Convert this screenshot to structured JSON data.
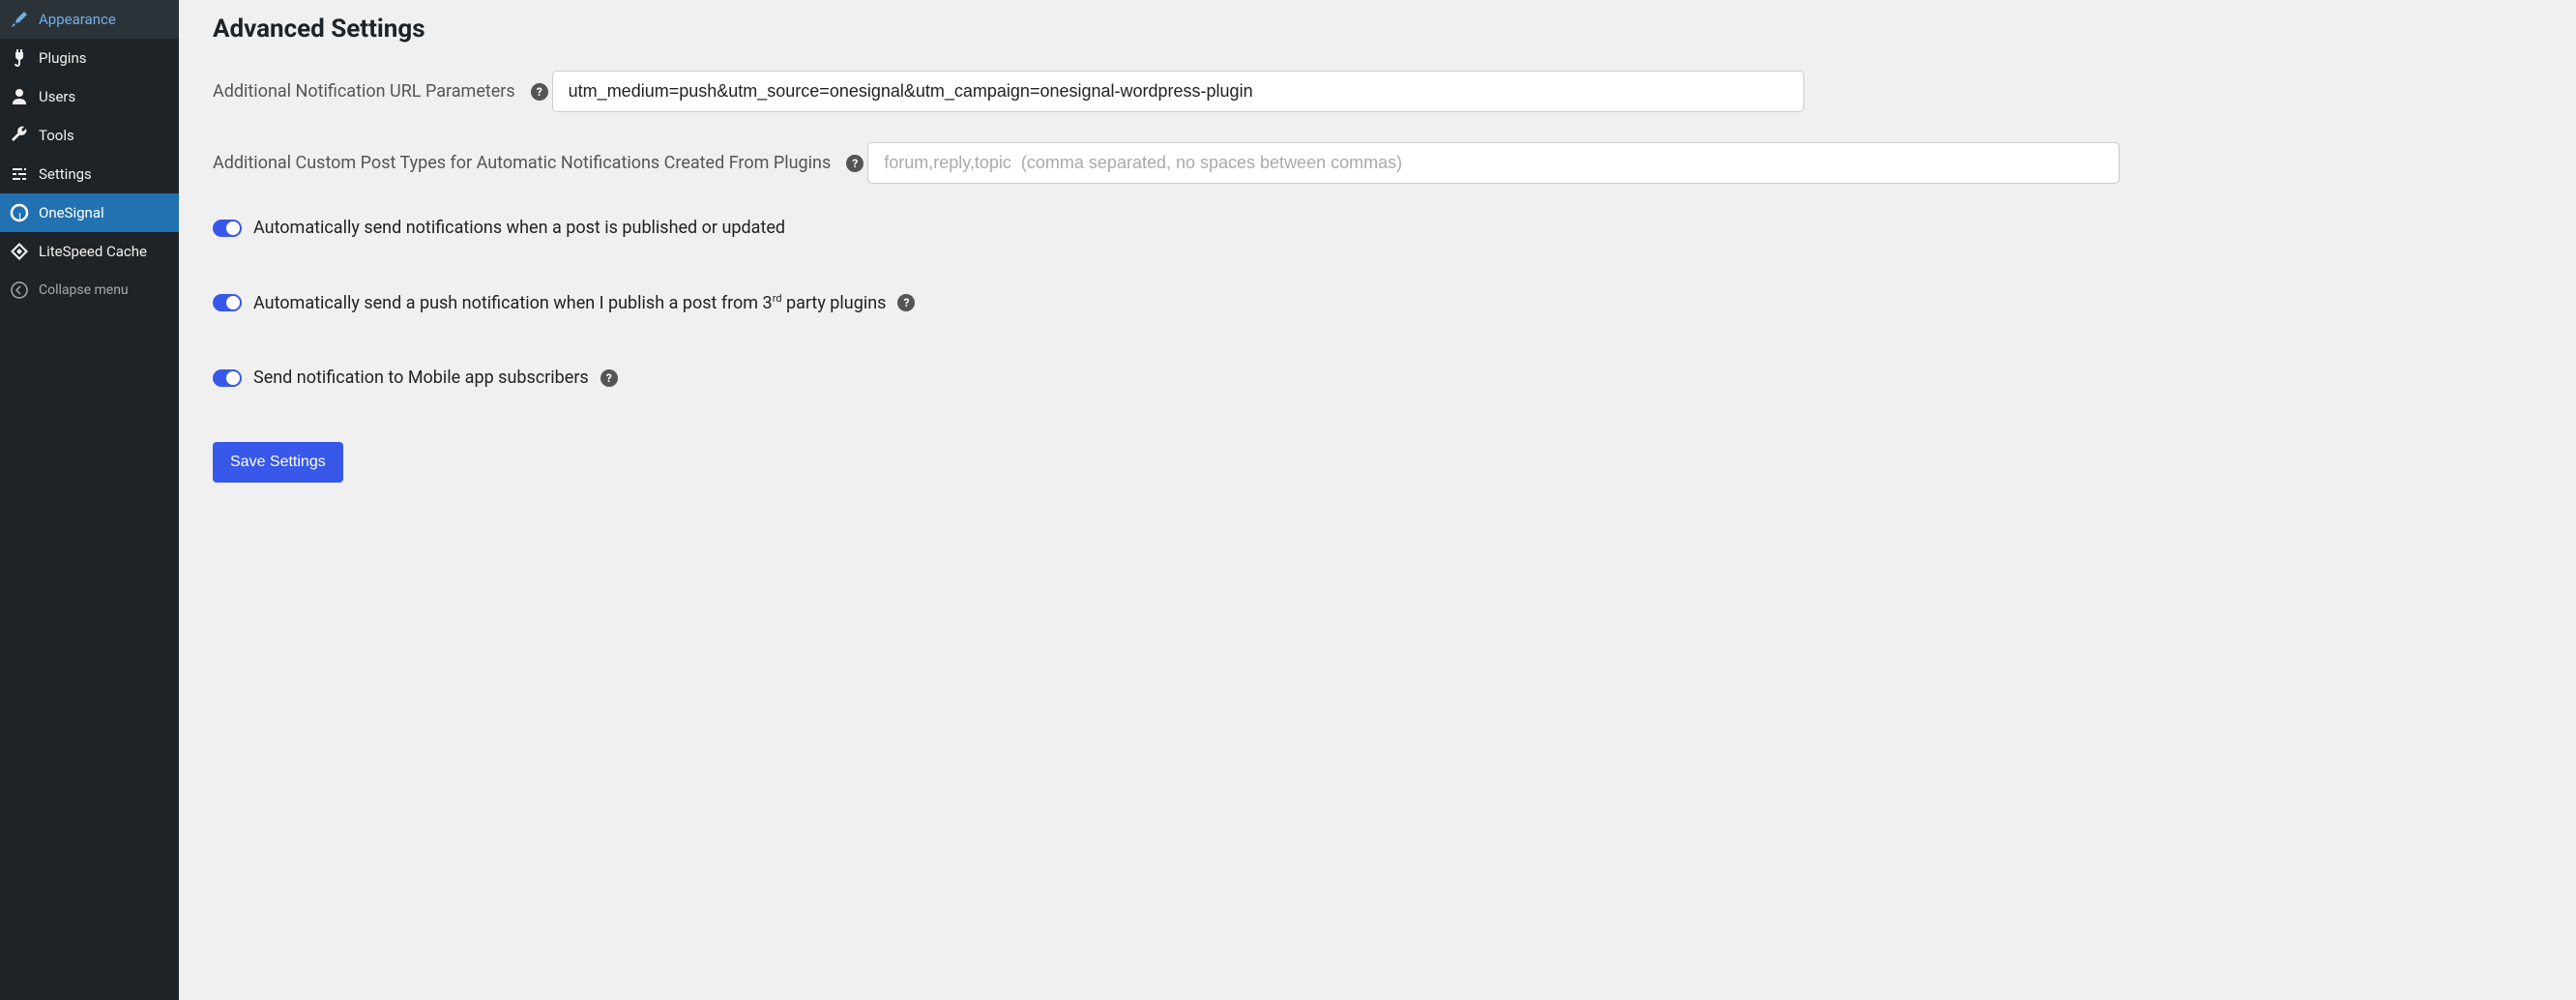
{
  "sidebar": {
    "items": [
      {
        "label": "Appearance",
        "icon": "paintbrush"
      },
      {
        "label": "Plugins",
        "icon": "plug"
      },
      {
        "label": "Users",
        "icon": "user"
      },
      {
        "label": "Tools",
        "icon": "wrench"
      },
      {
        "label": "Settings",
        "icon": "sliders"
      },
      {
        "label": "OneSignal",
        "icon": "onesignal",
        "active": true
      },
      {
        "label": "LiteSpeed Cache",
        "icon": "litespeed"
      }
    ],
    "collapse_label": "Collapse menu"
  },
  "page": {
    "title": "Advanced Settings",
    "field_url_params_label": "Additional Notification URL Parameters",
    "field_url_params_value": "utm_medium=push&utm_source=onesignal&utm_campaign=onesignal-wordpress-plugin",
    "field_post_types_label": "Additional Custom Post Types for Automatic Notifications Created From Plugins",
    "field_post_types_placeholder": "forum,reply,topic  (comma separated, no spaces between commas)",
    "toggle_auto_publish_label": "Automatically send notifications when a post is published or updated",
    "toggle_third_party_prefix": "Automatically send a push notification when I publish a post from 3",
    "toggle_third_party_sup": "rd",
    "toggle_third_party_suffix": " party plugins",
    "toggle_mobile_label": "Send notification to Mobile app subscribers",
    "save_button_label": "Save Settings"
  }
}
